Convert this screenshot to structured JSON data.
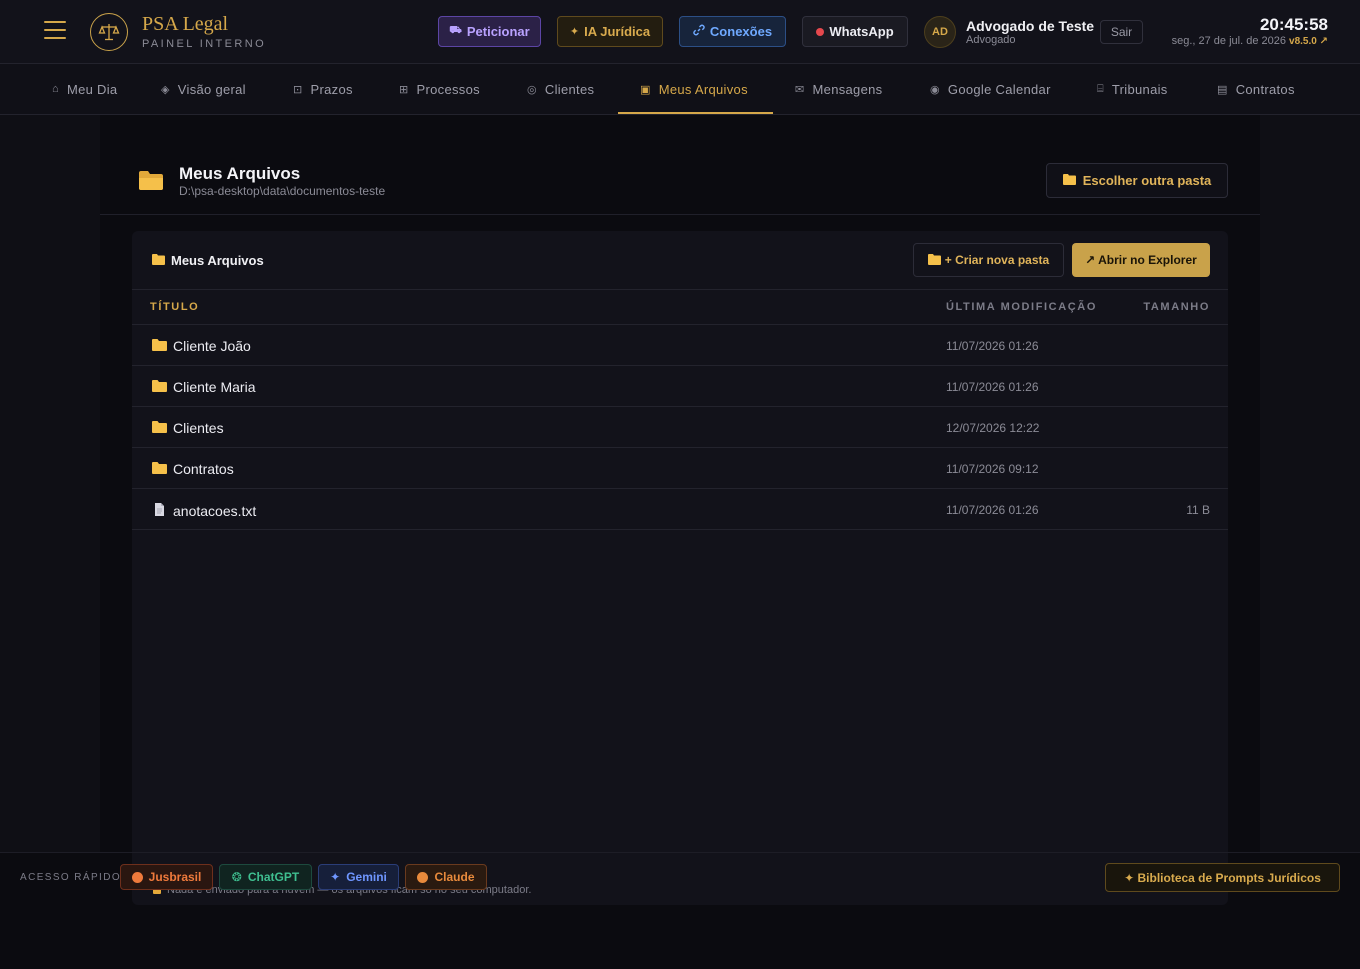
{
  "brand": {
    "title": "PSA Legal",
    "subtitle": "PAINEL INTERNO"
  },
  "header_buttons": {
    "peticionar": "Peticionar",
    "ia": "IA Jurídica",
    "conexoes": "Conexões",
    "whatsapp": "WhatsApp"
  },
  "user": {
    "initials": "AD",
    "name": "Advogado de Teste",
    "role": "Advogado",
    "logout": "Sair"
  },
  "clock": {
    "time": "20:45:58",
    "date": "seg., 27 de jul. de 2026",
    "version": "v8.5.0 ↗"
  },
  "nav": {
    "tabs": [
      {
        "icon": "⌂",
        "label": "Meu Dia"
      },
      {
        "icon": "◈",
        "label": "Visão geral"
      },
      {
        "icon": "⊡",
        "label": "Prazos"
      },
      {
        "icon": "⊞",
        "label": "Processos"
      },
      {
        "icon": "◎",
        "label": "Clientes"
      },
      {
        "icon": "▣",
        "label": "Meus Arquivos"
      },
      {
        "icon": "✉",
        "label": "Mensagens"
      },
      {
        "icon": "◉",
        "label": "Google Calendar"
      },
      {
        "icon": "⌸",
        "label": "Tribunais"
      },
      {
        "icon": "▤",
        "label": "Contratos"
      }
    ],
    "active_index": 5
  },
  "page": {
    "title": "Meus Arquivos",
    "path": "D:\\psa-desktop\\data\\documentos-teste",
    "choose_folder": "Escolher outra pasta"
  },
  "panel": {
    "title": "Meus Arquivos",
    "new_folder": "+ Criar nova pasta",
    "open_explorer": "↗ Abrir no Explorer",
    "columns": {
      "title": "TÍTULO",
      "modified": "ÚLTIMA MODIFICAÇÃO",
      "size": "TAMANHO"
    },
    "rows": [
      {
        "type": "folder",
        "name": "Cliente João",
        "modified": "11/07/2026 01:26",
        "size": ""
      },
      {
        "type": "folder",
        "name": "Cliente Maria",
        "modified": "11/07/2026 01:26",
        "size": ""
      },
      {
        "type": "folder",
        "name": "Clientes",
        "modified": "12/07/2026 12:22",
        "size": ""
      },
      {
        "type": "folder",
        "name": "Contratos",
        "modified": "11/07/2026 09:12",
        "size": ""
      },
      {
        "type": "file",
        "name": "anotacoes.txt",
        "modified": "11/07/2026 01:26",
        "size": "11 B"
      }
    ],
    "privacy_note": "Nada é enviado para a nuvem — os arquivos ficam só no seu computador."
  },
  "footer": {
    "label": "ACESSO RÁPIDO",
    "jusbrasil": "Jusbrasil",
    "chatgpt": "ChatGPT",
    "gemini": "Gemini",
    "claude": "Claude",
    "library": "✦ Biblioteca de Prompts Jurídicos"
  },
  "colors": {
    "accent": "#d6a84a",
    "background": "#0b0b10",
    "panel": "#12121a"
  }
}
